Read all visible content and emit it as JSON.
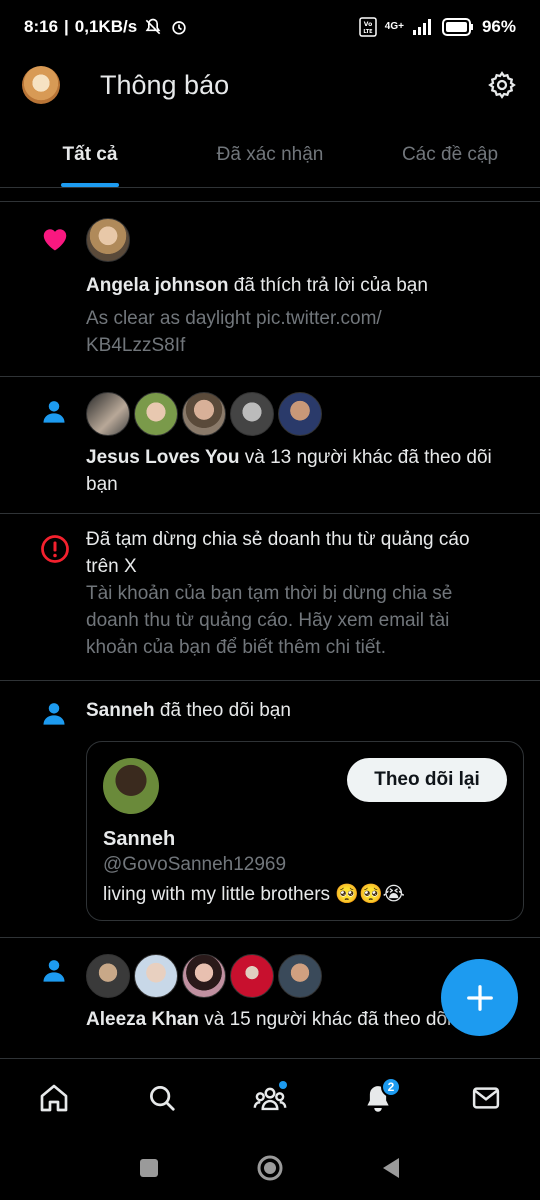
{
  "status": {
    "time": "8:16",
    "speed": "0,1KB/s",
    "network": "4G+",
    "battery": "96%"
  },
  "header": {
    "title": "Thông báo"
  },
  "tabs": [
    {
      "label": "Tất cả",
      "active": true
    },
    {
      "label": "Đã xác nhận",
      "active": false
    },
    {
      "label": "Các đề cập",
      "active": false
    }
  ],
  "notifications": [
    {
      "type": "like",
      "icon": "heart-icon",
      "actor": "Angela johnson",
      "action": " đã thích trả lời của bạn",
      "snippet_1": "As clear as daylight pic.twitter.com/",
      "snippet_2": "KB4LzzS8If"
    },
    {
      "type": "follow",
      "icon": "person-icon",
      "actor": "Jesus Loves You",
      "action_1": " và 13 người khác đã theo dõi",
      "action_2": "bạn"
    },
    {
      "type": "alert",
      "icon": "alert-icon",
      "title_1": "Đã tạm dừng chia sẻ doanh thu từ quảng cáo",
      "title_2": "trên X",
      "body_1": "Tài khoản của bạn tạm thời bị dừng chia sẻ",
      "body_2": "doanh thu từ quảng cáo. Hãy xem email tài",
      "body_3": "khoản của bạn để biết thêm chi tiết."
    },
    {
      "type": "follow",
      "icon": "person-icon",
      "actor": "Sanneh",
      "action": " đã theo dõi bạn",
      "card": {
        "name": "Sanneh",
        "handle": "@GovoSanneh12969",
        "bio": "living with my little brothers 🥺🥺😭",
        "button": "Theo dõi lại"
      }
    },
    {
      "type": "follow",
      "icon": "person-icon",
      "actor": "Aleeza Khan",
      "action": " và 15 người khác đã theo dõi bạn"
    }
  ],
  "bottom_nav": {
    "notifications_badge": "2"
  },
  "colors": {
    "accent": "#1d9bf0",
    "like": "#f91880",
    "alert": "#f4212e",
    "muted": "#71767b"
  }
}
